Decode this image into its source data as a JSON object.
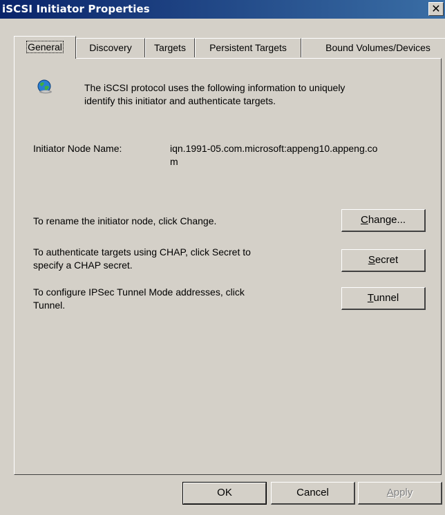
{
  "window": {
    "title": "iSCSI Initiator Properties",
    "close_glyph": "✕"
  },
  "tabs": [
    {
      "label": "General",
      "active": true
    },
    {
      "label": "Discovery"
    },
    {
      "label": "Targets"
    },
    {
      "label": "Persistent Targets"
    },
    {
      "label": "Bound Volumes/Devices"
    }
  ],
  "general": {
    "intro_line1": "The iSCSI protocol uses the following information to uniquely",
    "intro_line2": "identify this initiator and authenticate targets.",
    "node_name_label": "Initiator Node Name:",
    "node_name_line1": "iqn.1991-05.com.microsoft:appeng10.appeng.co",
    "node_name_line2": "m",
    "rename_text": "To rename the initiator node, click Change.",
    "chap_line1": "To authenticate targets using CHAP, click Secret to",
    "chap_line2": "specify a CHAP secret.",
    "tunnel_line1": "To configure IPSec Tunnel Mode addresses, click",
    "tunnel_line2": "Tunnel.",
    "change_button": {
      "mnemonic": "C",
      "rest": "hange..."
    },
    "secret_button": {
      "mnemonic": "S",
      "rest": "ecret"
    },
    "tunnel_button": {
      "mnemonic": "T",
      "rest": "unnel"
    }
  },
  "footer": {
    "ok_label": "OK",
    "cancel_label": "Cancel",
    "apply_button": {
      "mnemonic": "A",
      "rest": "pply"
    }
  },
  "icons": {
    "globe": "globe-network-icon",
    "close": "close-icon"
  },
  "colors": {
    "titlebar_start": "#0a246a",
    "titlebar_end": "#3a6ea5",
    "face": "#d4d0c8"
  }
}
